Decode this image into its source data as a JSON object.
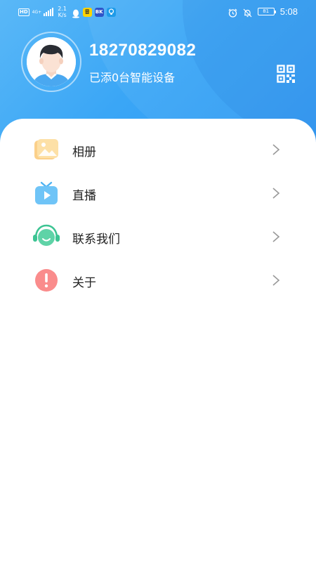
{
  "status_bar": {
    "hd": "HD",
    "network": "4G+",
    "speed_value": "2.1",
    "speed_unit": "K/s",
    "app_badge_1": "音",
    "app_badge_2": "BK",
    "battery": "81",
    "time": "5:08"
  },
  "profile": {
    "phone": "18270829082",
    "subtitle": "已添0台智能设备",
    "qr_icon": "qr-code-icon"
  },
  "menu": [
    {
      "label": "相册",
      "icon": "album-icon"
    },
    {
      "label": "直播",
      "icon": "live-tv-icon"
    },
    {
      "label": "联系我们",
      "icon": "customer-service-icon"
    },
    {
      "label": "关于",
      "icon": "about-icon"
    }
  ],
  "colors": {
    "header_start": "#5ab8f7",
    "header_end": "#2b96f2",
    "text": "#222222",
    "chevron": "#999999"
  }
}
